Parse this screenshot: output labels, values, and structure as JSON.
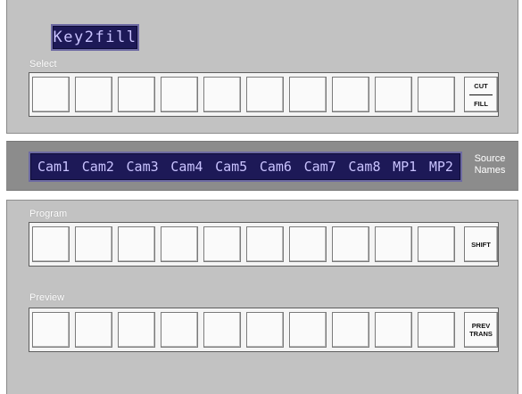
{
  "key_display": "Key2fill",
  "select": {
    "label": "Select",
    "buttons": [
      "",
      "",
      "",
      "",
      "",
      "",
      "",
      "",
      "",
      ""
    ],
    "cut_label": "CUT",
    "fill_label": "FILL"
  },
  "source_names": {
    "label_line1": "Source",
    "label_line2": "Names",
    "names": [
      "Cam1",
      "Cam2",
      "Cam3",
      "Cam4",
      "Cam5",
      "Cam6",
      "Cam7",
      "Cam8",
      "MP1",
      "MP2"
    ]
  },
  "program": {
    "label": "Program",
    "shift_label": "SHIFT"
  },
  "preview": {
    "label": "Preview",
    "prev_label_1": "PREV",
    "prev_label_2": "TRANS"
  },
  "colors": {
    "panel": "#c2c2c2",
    "lcd_background": "#1d1957",
    "lcd_text": "#c9c3ff"
  }
}
